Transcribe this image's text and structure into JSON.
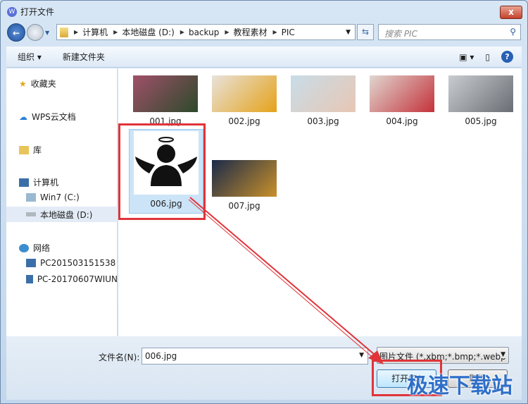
{
  "window": {
    "title": "打开文件",
    "close": "x"
  },
  "address": {
    "crumbs": [
      "计算机",
      "本地磁盘 (D:)",
      "backup",
      "教程素材",
      "PIC"
    ]
  },
  "search": {
    "placeholder": "搜索 PIC"
  },
  "toolbar": {
    "organize": "组织 ▾",
    "new_folder": "新建文件夹",
    "help": "?"
  },
  "sidebar": {
    "items": [
      {
        "label": "收藏夹",
        "icon": "star-icon"
      },
      {
        "label": "WPS云文档",
        "icon": "cloud-icon"
      },
      {
        "label": "库",
        "icon": "library-icon"
      },
      {
        "label": "计算机",
        "icon": "computer-icon"
      },
      {
        "label": "Win7 (C:)",
        "icon": "drive-icon"
      },
      {
        "label": "本地磁盘 (D:)",
        "icon": "drive-icon"
      },
      {
        "label": "网络",
        "icon": "network-icon"
      },
      {
        "label": "PC201503151538",
        "icon": "pc-icon"
      },
      {
        "label": "PC-20170607WIUN",
        "icon": "pc-icon"
      }
    ]
  },
  "files": [
    {
      "name": "001.jpg",
      "colors": [
        "#a0506a",
        "#2c4a2a"
      ]
    },
    {
      "name": "002.jpg",
      "colors": [
        "#e8e2da",
        "#e5a21a"
      ]
    },
    {
      "name": "003.jpg",
      "colors": [
        "#c8dde8",
        "#e8c6b4"
      ]
    },
    {
      "name": "004.jpg",
      "colors": [
        "#e0d6d0",
        "#c4323a"
      ]
    },
    {
      "name": "005.jpg",
      "colors": [
        "#c9ccd0",
        "#6a6e74"
      ]
    },
    {
      "name": "006.jpg",
      "colors": [
        "#ffffff",
        "#111111"
      ]
    },
    {
      "name": "007.jpg",
      "colors": [
        "#1a2a4a",
        "#c9902a"
      ]
    }
  ],
  "selected_file": "006.jpg",
  "footer": {
    "filename_label": "文件名(N):",
    "filename_value": "006.jpg",
    "filetype": "图片文件 (*.xbm;*.bmp;*.webp",
    "open": "打开(O)",
    "cancel": "取消"
  },
  "watermark": "极速下载站",
  "accent_colors": {
    "highlight": "#e0343a",
    "selection": "#cce4f7"
  }
}
